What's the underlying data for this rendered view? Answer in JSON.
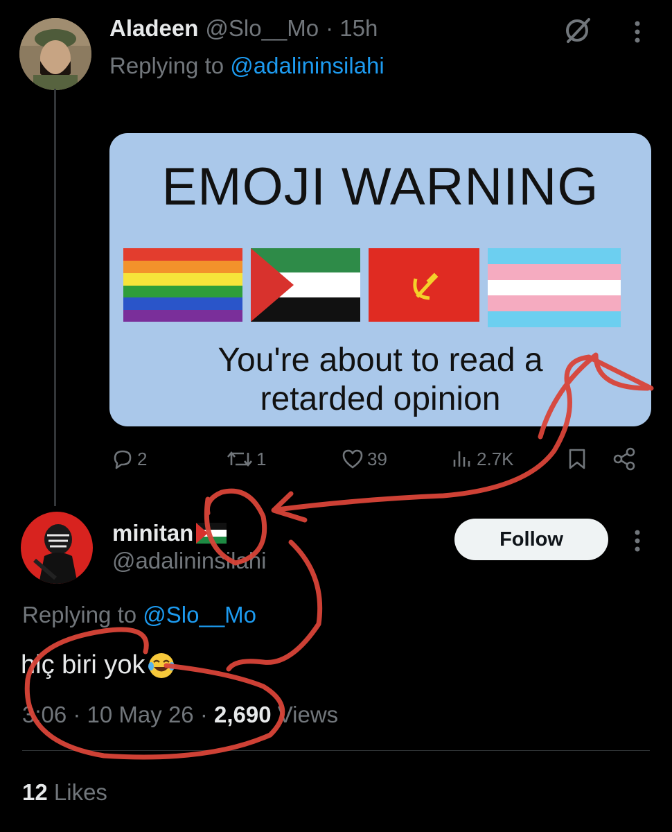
{
  "tweet1": {
    "author_name": "Aladeen",
    "handle": "@Slo__Mo",
    "time": "· 15h",
    "replying_prefix": "Replying to",
    "replying_handle": "@adalininsilahi",
    "meme": {
      "title": "EMOJI WARNING",
      "caption_line1": "You're about to read a",
      "caption_line2": "retarded opinion"
    },
    "actions": {
      "replies": "2",
      "reposts": "1",
      "likes": "39",
      "views": "2.7K"
    }
  },
  "tweet2": {
    "author_name": "minitan",
    "handle": "@adalininsilahi",
    "follow_label": "Follow",
    "replying_prefix": "Replying to",
    "replying_handle": "@Slo__Mo",
    "text": "hiç biri yok",
    "meta_time": "3:06 · 10 May 26 ·",
    "views_count": "2,690",
    "views_label": "Views",
    "likes_count": "12",
    "likes_label": "Likes"
  },
  "icons": {
    "grok": "slashed-circle-icon",
    "more": "more-vertical-icon",
    "reply": "reply-icon",
    "repost": "repost-icon",
    "like": "heart-icon",
    "views": "bar-chart-icon",
    "bookmark": "bookmark-icon",
    "share": "share-icon",
    "emoji": "face-with-tears-of-joy-icon",
    "flag": "palestine-flag-icon"
  },
  "colors": {
    "background": "#000000",
    "text": "#e7e9ea",
    "muted": "#71767b",
    "link": "#1d9bf0",
    "annotation": "#d94438",
    "meme_bg": "#aac8ea"
  }
}
